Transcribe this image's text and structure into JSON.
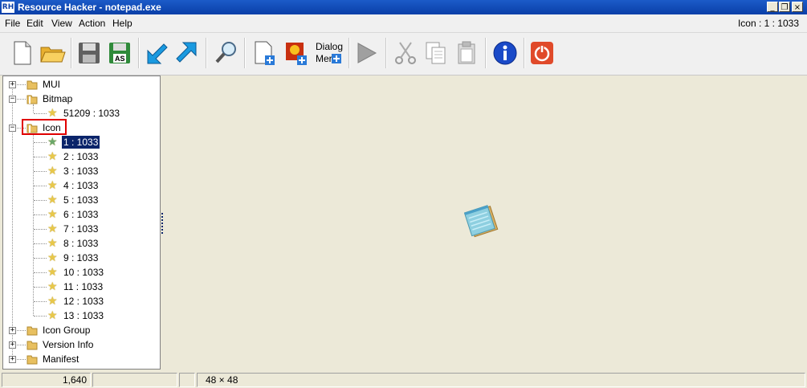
{
  "window": {
    "app_icon": "RH",
    "title": "Resource Hacker - notepad.exe",
    "controls": [
      "minimize",
      "restore",
      "close"
    ],
    "minimize_glyph": "_",
    "restore_glyph": "❐",
    "close_glyph": "×"
  },
  "menu": {
    "file": "File",
    "edit": "Edit",
    "view": "View",
    "action": "Action",
    "help": "Help",
    "resource_info": "Icon : 1 : 1033"
  },
  "toolbar": {
    "buttons": [
      "new-file-icon",
      "open-folder-icon",
      "save-icon",
      "save-as-icon",
      "import-icon",
      "export-icon",
      "search-icon",
      "add-resource-icon",
      "add-image-icon",
      "dialog-merger-icon",
      "run-script-icon",
      "cut-icon",
      "copy-icon",
      "paste-icon",
      "info-icon",
      "power-icon"
    ],
    "save_as_text": "AS",
    "dialog_line1": "Dialog",
    "dialog_line2": "Mer"
  },
  "tree": {
    "mui": "MUI",
    "bitmap": "Bitmap",
    "bitmap_child": "51209 : 1033",
    "icon": "Icon",
    "icon_children": [
      "1 : 1033",
      "2 : 1033",
      "3 : 1033",
      "4 : 1033",
      "5 : 1033",
      "6 : 1033",
      "7 : 1033",
      "8 : 1033",
      "9 : 1033",
      "10 : 1033",
      "11 : 1033",
      "12 : 1033",
      "13 : 1033"
    ],
    "icon_group": "Icon Group",
    "version_info": "Version Info",
    "manifest": "Manifest",
    "expand_glyph": "+",
    "collapse_glyph": "−"
  },
  "preview": {
    "image": "notepad-icon"
  },
  "status": {
    "size": "1,640",
    "dimensions": "48 × 48"
  },
  "colors": {
    "title_bar": "#0a3fa8",
    "selection": "#0a246a",
    "highlight_box": "#e00000",
    "folder": "#e8c060",
    "star": "#e8c84a"
  }
}
